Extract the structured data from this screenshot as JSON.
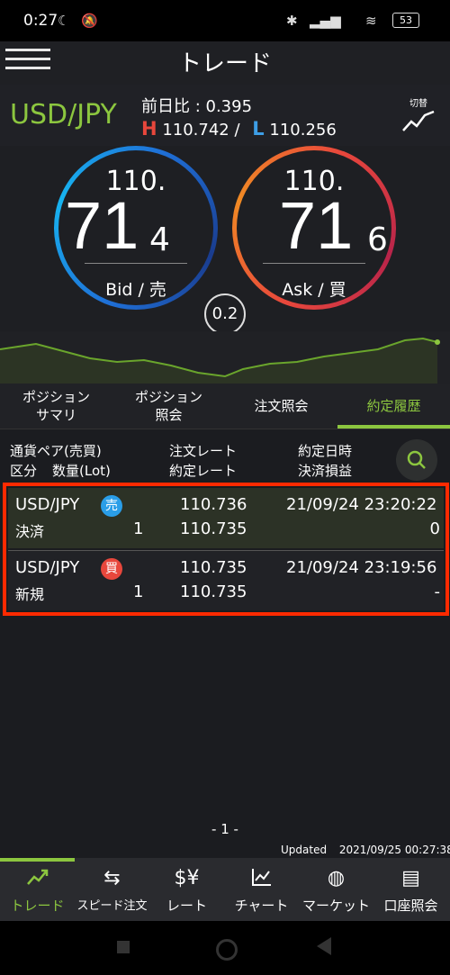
{
  "status_bar": {
    "time": "0:27",
    "battery": "53"
  },
  "header": {
    "title": "トレード"
  },
  "pair": {
    "symbol": "USD/JPY",
    "prev_change": "前日比 : 0.395",
    "high_label": "H",
    "high": "110.742 /",
    "low_label": "L",
    "low": "110.256",
    "switch_label": "切替"
  },
  "bid": {
    "top": "110.",
    "big": "71",
    "small": "4",
    "label": "Bid / 売"
  },
  "ask": {
    "top": "110.",
    "big": "71",
    "small": "6",
    "label": "Ask / 買"
  },
  "spread": "0.2",
  "tabs": [
    {
      "label": "ポジション サマリ"
    },
    {
      "label": "ポジション 照会"
    },
    {
      "label": "注文照会"
    },
    {
      "label": "約定履歴"
    }
  ],
  "columns": {
    "pair": "通貨ペア(売買)",
    "kubun": "区分",
    "qty": "数量(Lot)",
    "order_rate": "注文レート",
    "exec_rate": "約定レート",
    "exec_date": "約定日時",
    "pnl": "決済損益"
  },
  "rows": [
    {
      "pair": "USD/JPY",
      "side": "売",
      "side_color": "#2a9ee8",
      "order_rate": "110.736",
      "datetime": "21/09/24 23:20:22",
      "kubun": "決済",
      "qty": "1",
      "exec_rate": "110.735",
      "pnl": "0"
    },
    {
      "pair": "USD/JPY",
      "side": "買",
      "side_color": "#e8473c",
      "order_rate": "110.735",
      "datetime": "21/09/24 23:19:56",
      "kubun": "新規",
      "qty": "1",
      "exec_rate": "110.735",
      "pnl": "-"
    }
  ],
  "page": "- 1 -",
  "updated_label": "Updated",
  "updated_time": "2021/09/25  00:27:38",
  "nav": [
    {
      "label": "トレード",
      "icon": "trade-chart-icon"
    },
    {
      "label": "スピード注文",
      "icon": "speed-order-icon"
    },
    {
      "label": "レート",
      "icon": "rate-icon"
    },
    {
      "label": "チャート",
      "icon": "chart-icon"
    },
    {
      "label": "マーケット",
      "icon": "globe-icon"
    },
    {
      "label": "口座照会",
      "icon": "account-icon"
    }
  ],
  "colors": {
    "accent": "#8cc63f",
    "highlight_box": "#ff2a00"
  }
}
